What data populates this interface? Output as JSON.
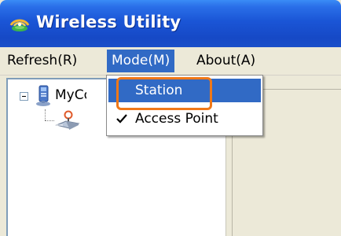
{
  "window": {
    "title": "Wireless Utility",
    "title_icon": "wireless-utility-icon"
  },
  "menubar": {
    "items": [
      {
        "label": "Refresh(R)"
      },
      {
        "label": "Mode(M)",
        "active": true
      },
      {
        "label": "About(A)"
      }
    ]
  },
  "tree": {
    "root_label": "MyComputer",
    "root_icon": "computer-icon",
    "child_icon": "wireless-adapter-icon"
  },
  "mode_menu": {
    "items": [
      {
        "label": "Station",
        "highlighted": true,
        "checked": false
      },
      {
        "label": "Access Point",
        "highlighted": false,
        "checked": true
      }
    ]
  },
  "colors": {
    "title_bar": "#1a55d6",
    "menu_highlight": "#316ac5",
    "annotation_box": "#f07818",
    "window_bg": "#ece9d8"
  }
}
